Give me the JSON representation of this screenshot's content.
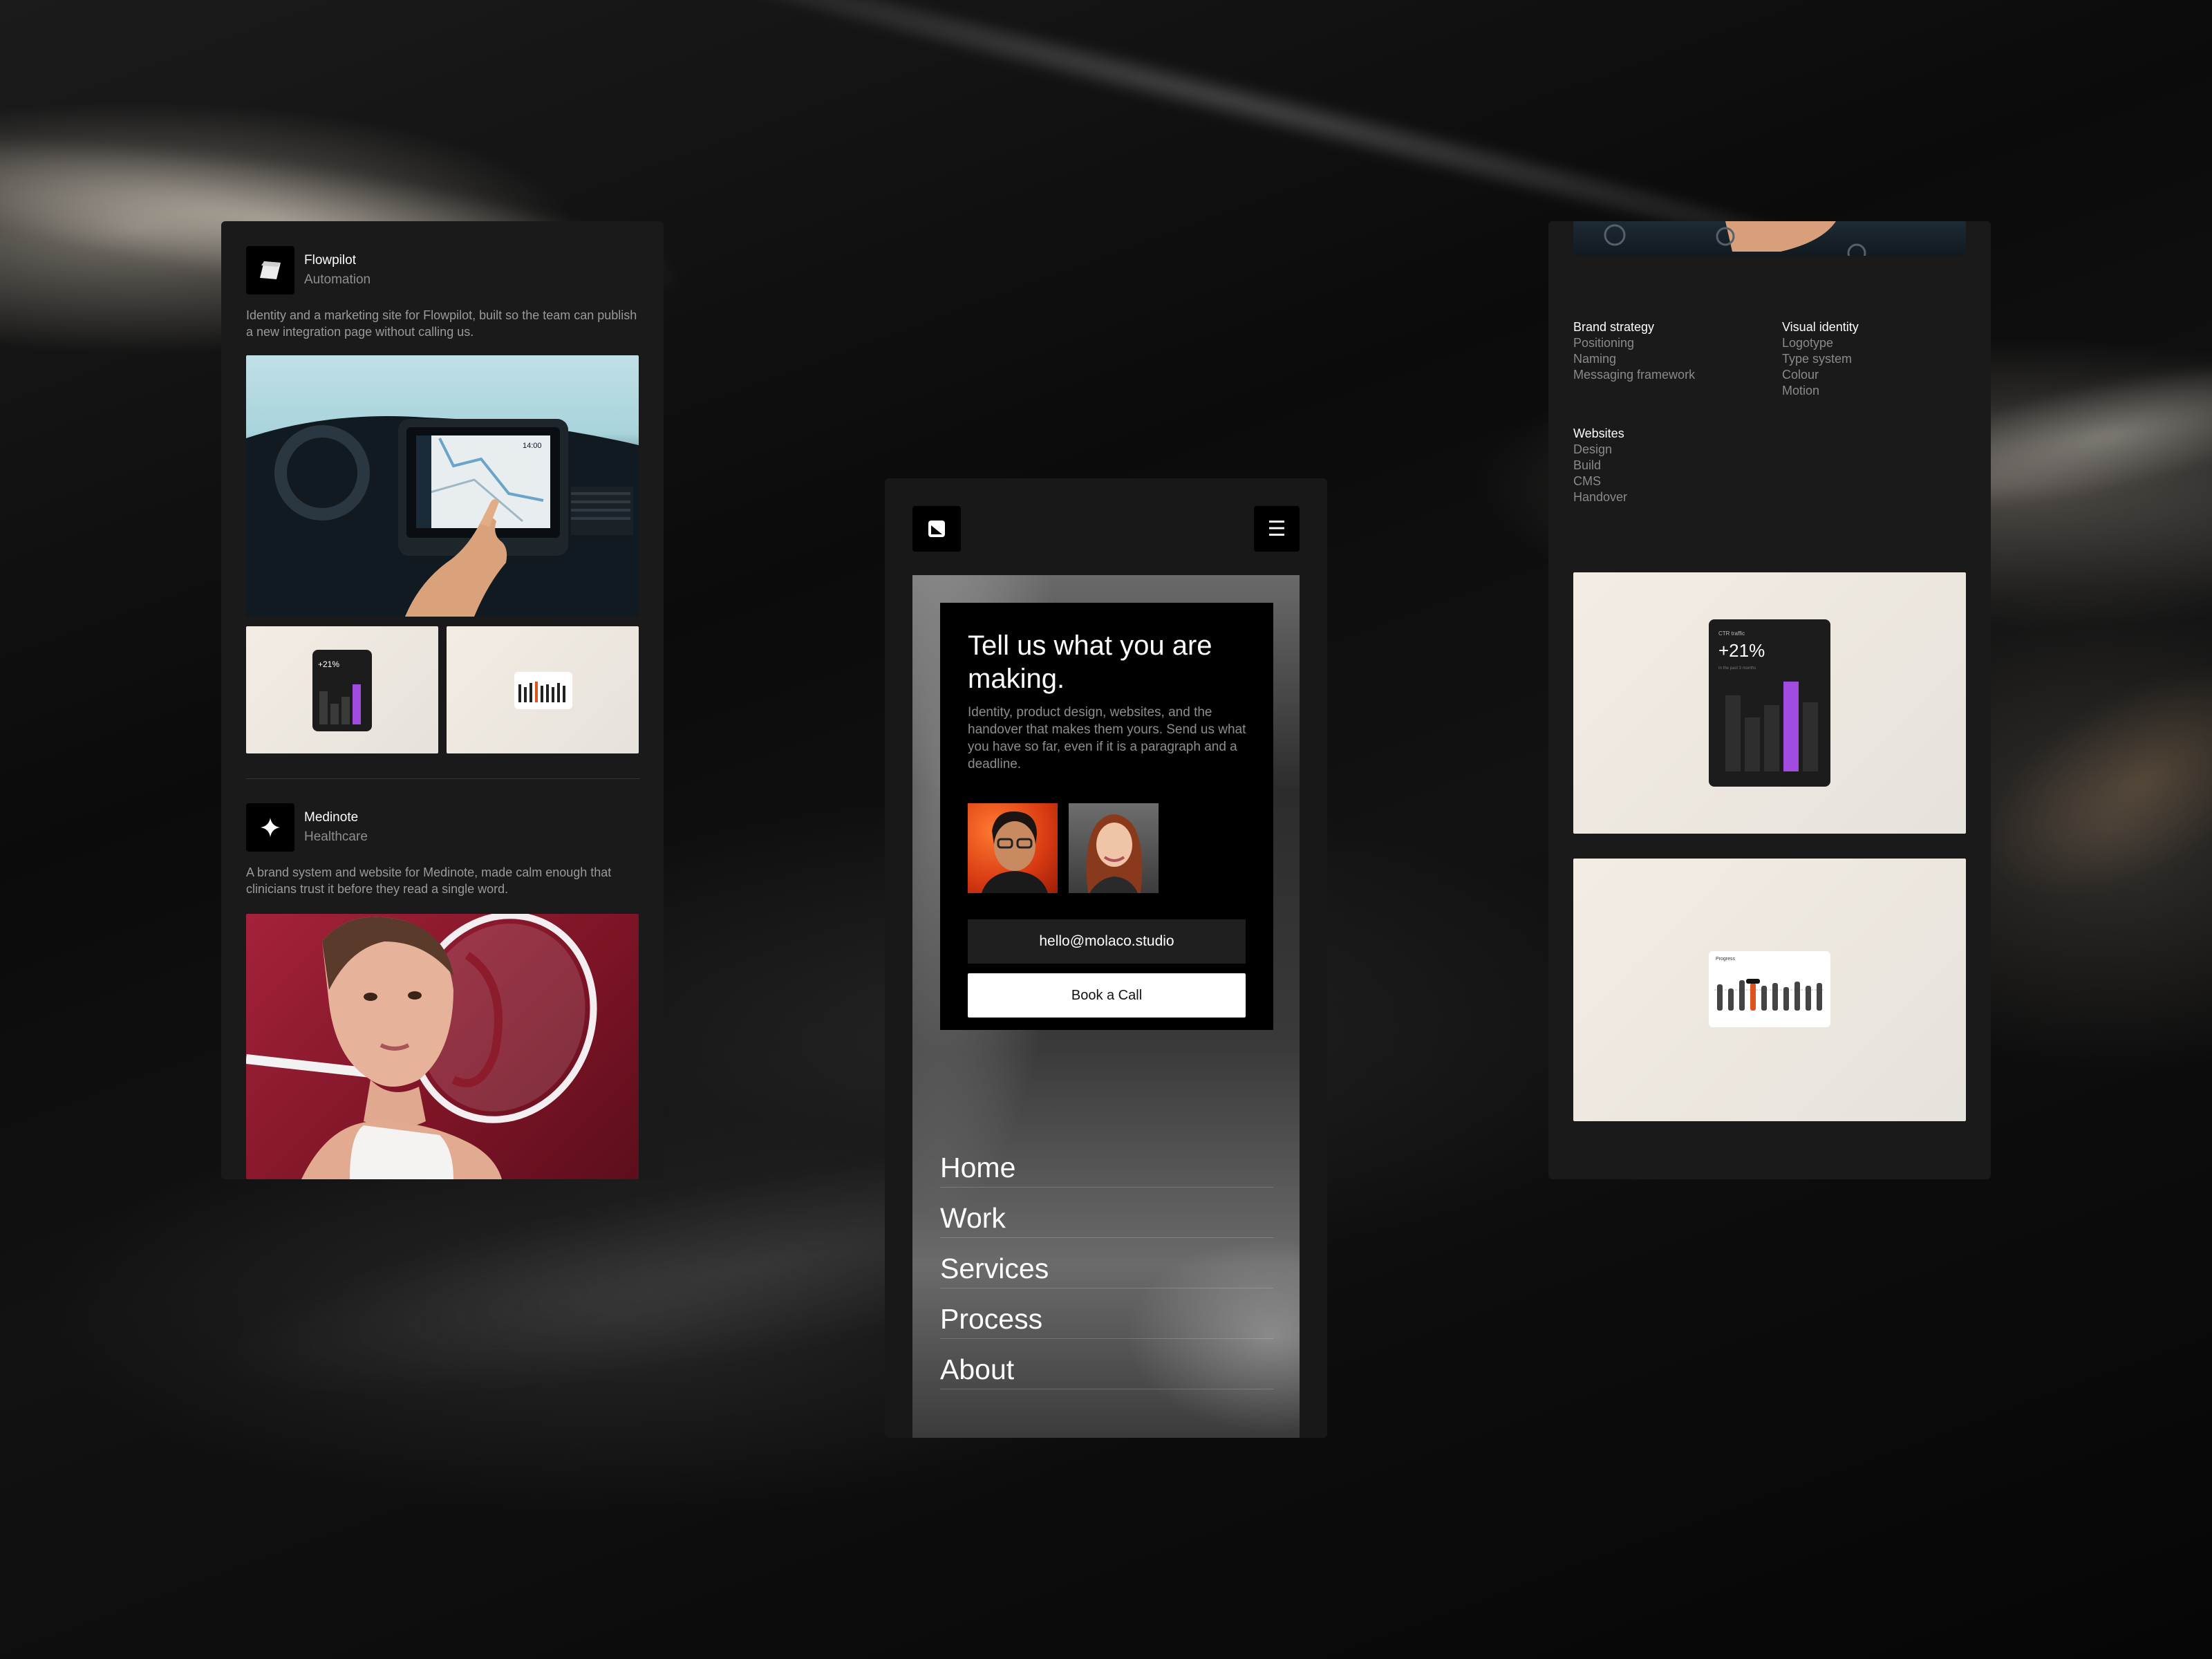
{
  "left": {
    "projects": [
      {
        "name": "Flowpilot",
        "category": "Automation",
        "description": "Identity and a marketing site for Flowpilot, built so the team can publish a new integration page without calling us.",
        "thumb_stat": "+21%",
        "dash_clock": "14:00"
      },
      {
        "name": "Medinote",
        "category": "Healthcare",
        "description": "A brand system and website for Medinote, made calm enough that clinicians trust it before they read a single word."
      }
    ]
  },
  "center": {
    "title": "Tell us what you are making.",
    "body": "Identity, product design, websites, and the handover that makes them yours. Send us what you have so far, even if it is a paragraph and a deadline.",
    "email": "hello@molaco.studio",
    "cta": "Book a Call",
    "nav": [
      "Home",
      "Work",
      "Services",
      "Process",
      "About"
    ]
  },
  "right": {
    "services": [
      {
        "heading": "Brand strategy",
        "items": [
          "Positioning",
          "Naming",
          "Messaging framework"
        ]
      },
      {
        "heading": "Visual identity",
        "items": [
          "Logotype",
          "Type system",
          "Colour",
          "Motion"
        ]
      },
      {
        "heading": "Websites",
        "items": [
          "Design",
          "Build",
          "CMS",
          "Handover"
        ]
      }
    ],
    "stat_card": {
      "label": "CTR traffic",
      "value": "+21%",
      "sub": "In the past 3 months"
    },
    "progress_card": {
      "label": "Progress"
    }
  },
  "colors": {
    "accent_purple": "#a24be0",
    "accent_orange": "#e0521f",
    "panel": "#1a1a1a"
  }
}
